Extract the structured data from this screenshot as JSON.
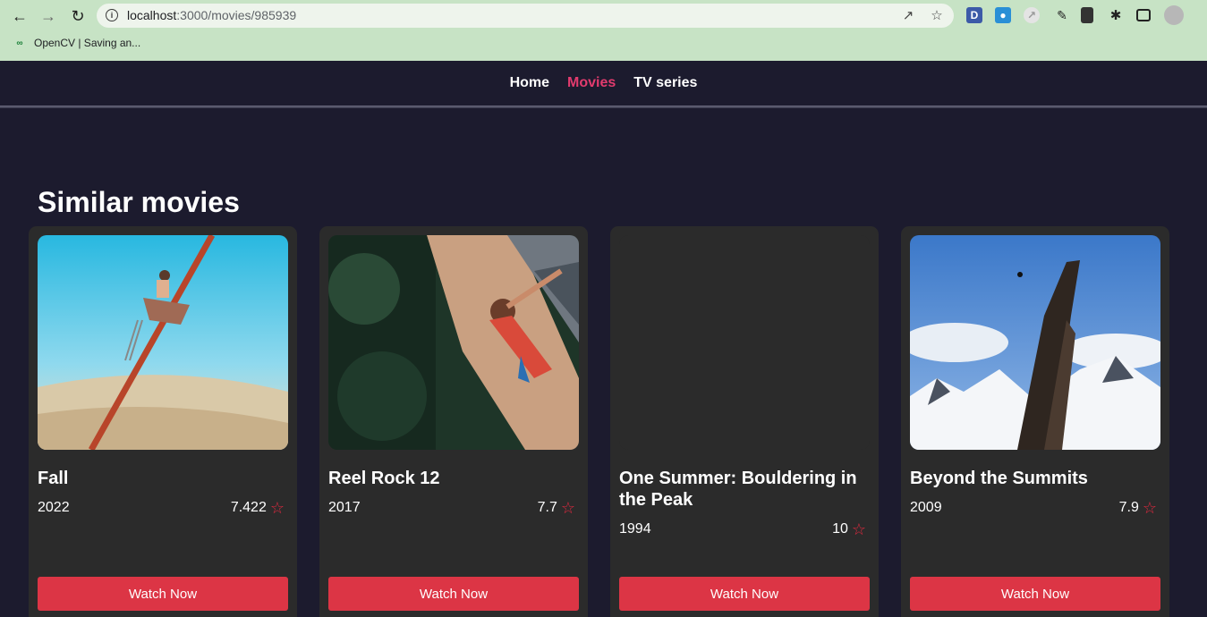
{
  "browser": {
    "url_host": "localhost",
    "url_path": ":3000/movies/985939",
    "bookmark": "OpenCV | Saving an..."
  },
  "nav": {
    "links": [
      {
        "label": "Home",
        "active": false
      },
      {
        "label": "Movies",
        "active": true
      },
      {
        "label": "TV series",
        "active": false
      }
    ]
  },
  "section_title": "Similar movies",
  "movies": [
    {
      "title": "Fall",
      "year": "2022",
      "rating": "7.422",
      "button": "Watch Now"
    },
    {
      "title": "Reel Rock 12",
      "year": "2017",
      "rating": "7.7",
      "button": "Watch Now"
    },
    {
      "title": "One Summer: Bouldering in the Peak",
      "year": "1994",
      "rating": "10",
      "button": "Watch Now"
    },
    {
      "title": "Beyond the Summits",
      "year": "2009",
      "rating": "7.9",
      "button": "Watch Now"
    }
  ],
  "colors": {
    "accent": "#e23b6e",
    "button": "#dc3545",
    "background": "#1c1b2e",
    "card": "#2b2b2b"
  }
}
